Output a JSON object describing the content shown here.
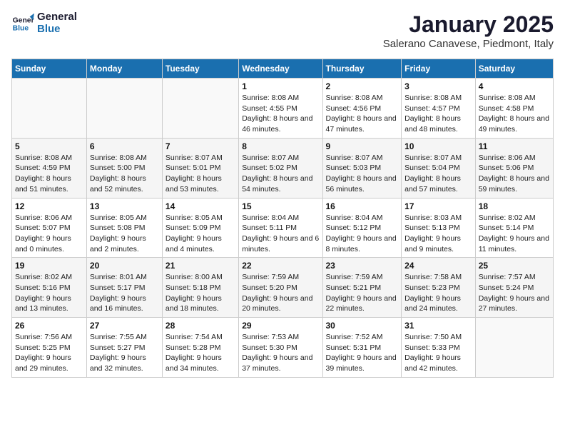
{
  "header": {
    "logo_line1": "General",
    "logo_line2": "Blue",
    "title": "January 2025",
    "subtitle": "Salerano Canavese, Piedmont, Italy"
  },
  "days_of_week": [
    "Sunday",
    "Monday",
    "Tuesday",
    "Wednesday",
    "Thursday",
    "Friday",
    "Saturday"
  ],
  "weeks": [
    [
      {
        "day": "",
        "info": ""
      },
      {
        "day": "",
        "info": ""
      },
      {
        "day": "",
        "info": ""
      },
      {
        "day": "1",
        "info": "Sunrise: 8:08 AM\nSunset: 4:55 PM\nDaylight: 8 hours and 46 minutes."
      },
      {
        "day": "2",
        "info": "Sunrise: 8:08 AM\nSunset: 4:56 PM\nDaylight: 8 hours and 47 minutes."
      },
      {
        "day": "3",
        "info": "Sunrise: 8:08 AM\nSunset: 4:57 PM\nDaylight: 8 hours and 48 minutes."
      },
      {
        "day": "4",
        "info": "Sunrise: 8:08 AM\nSunset: 4:58 PM\nDaylight: 8 hours and 49 minutes."
      }
    ],
    [
      {
        "day": "5",
        "info": "Sunrise: 8:08 AM\nSunset: 4:59 PM\nDaylight: 8 hours and 51 minutes."
      },
      {
        "day": "6",
        "info": "Sunrise: 8:08 AM\nSunset: 5:00 PM\nDaylight: 8 hours and 52 minutes."
      },
      {
        "day": "7",
        "info": "Sunrise: 8:07 AM\nSunset: 5:01 PM\nDaylight: 8 hours and 53 minutes."
      },
      {
        "day": "8",
        "info": "Sunrise: 8:07 AM\nSunset: 5:02 PM\nDaylight: 8 hours and 54 minutes."
      },
      {
        "day": "9",
        "info": "Sunrise: 8:07 AM\nSunset: 5:03 PM\nDaylight: 8 hours and 56 minutes."
      },
      {
        "day": "10",
        "info": "Sunrise: 8:07 AM\nSunset: 5:04 PM\nDaylight: 8 hours and 57 minutes."
      },
      {
        "day": "11",
        "info": "Sunrise: 8:06 AM\nSunset: 5:06 PM\nDaylight: 8 hours and 59 minutes."
      }
    ],
    [
      {
        "day": "12",
        "info": "Sunrise: 8:06 AM\nSunset: 5:07 PM\nDaylight: 9 hours and 0 minutes."
      },
      {
        "day": "13",
        "info": "Sunrise: 8:05 AM\nSunset: 5:08 PM\nDaylight: 9 hours and 2 minutes."
      },
      {
        "day": "14",
        "info": "Sunrise: 8:05 AM\nSunset: 5:09 PM\nDaylight: 9 hours and 4 minutes."
      },
      {
        "day": "15",
        "info": "Sunrise: 8:04 AM\nSunset: 5:11 PM\nDaylight: 9 hours and 6 minutes."
      },
      {
        "day": "16",
        "info": "Sunrise: 8:04 AM\nSunset: 5:12 PM\nDaylight: 9 hours and 8 minutes."
      },
      {
        "day": "17",
        "info": "Sunrise: 8:03 AM\nSunset: 5:13 PM\nDaylight: 9 hours and 9 minutes."
      },
      {
        "day": "18",
        "info": "Sunrise: 8:02 AM\nSunset: 5:14 PM\nDaylight: 9 hours and 11 minutes."
      }
    ],
    [
      {
        "day": "19",
        "info": "Sunrise: 8:02 AM\nSunset: 5:16 PM\nDaylight: 9 hours and 13 minutes."
      },
      {
        "day": "20",
        "info": "Sunrise: 8:01 AM\nSunset: 5:17 PM\nDaylight: 9 hours and 16 minutes."
      },
      {
        "day": "21",
        "info": "Sunrise: 8:00 AM\nSunset: 5:18 PM\nDaylight: 9 hours and 18 minutes."
      },
      {
        "day": "22",
        "info": "Sunrise: 7:59 AM\nSunset: 5:20 PM\nDaylight: 9 hours and 20 minutes."
      },
      {
        "day": "23",
        "info": "Sunrise: 7:59 AM\nSunset: 5:21 PM\nDaylight: 9 hours and 22 minutes."
      },
      {
        "day": "24",
        "info": "Sunrise: 7:58 AM\nSunset: 5:23 PM\nDaylight: 9 hours and 24 minutes."
      },
      {
        "day": "25",
        "info": "Sunrise: 7:57 AM\nSunset: 5:24 PM\nDaylight: 9 hours and 27 minutes."
      }
    ],
    [
      {
        "day": "26",
        "info": "Sunrise: 7:56 AM\nSunset: 5:25 PM\nDaylight: 9 hours and 29 minutes."
      },
      {
        "day": "27",
        "info": "Sunrise: 7:55 AM\nSunset: 5:27 PM\nDaylight: 9 hours and 32 minutes."
      },
      {
        "day": "28",
        "info": "Sunrise: 7:54 AM\nSunset: 5:28 PM\nDaylight: 9 hours and 34 minutes."
      },
      {
        "day": "29",
        "info": "Sunrise: 7:53 AM\nSunset: 5:30 PM\nDaylight: 9 hours and 37 minutes."
      },
      {
        "day": "30",
        "info": "Sunrise: 7:52 AM\nSunset: 5:31 PM\nDaylight: 9 hours and 39 minutes."
      },
      {
        "day": "31",
        "info": "Sunrise: 7:50 AM\nSunset: 5:33 PM\nDaylight: 9 hours and 42 minutes."
      },
      {
        "day": "",
        "info": ""
      }
    ]
  ]
}
